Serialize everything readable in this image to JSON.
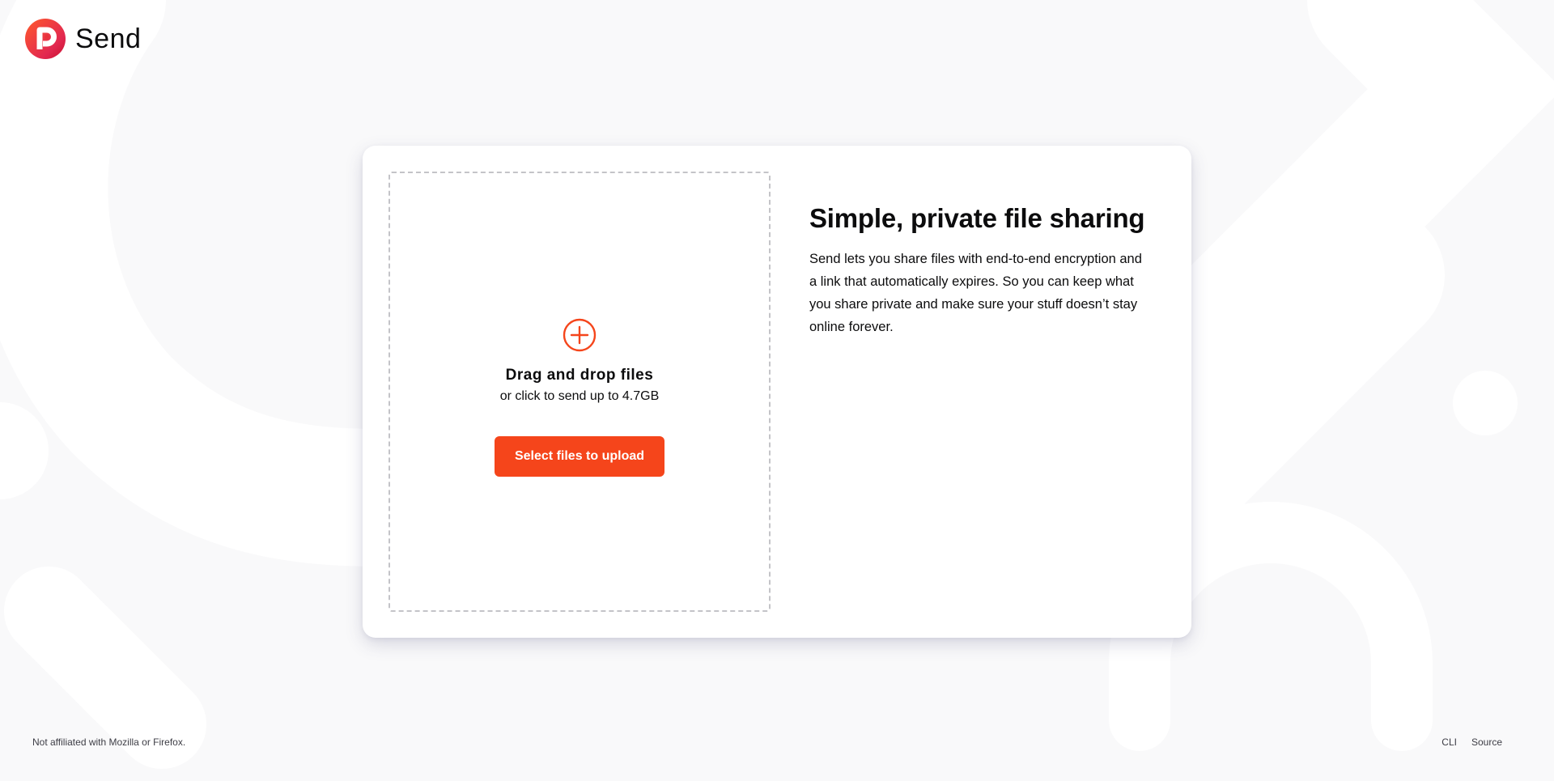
{
  "header": {
    "brand_name": "Send",
    "logo_icon": "send-logo-icon"
  },
  "upload": {
    "icon": "plus-circle-icon",
    "title": "Drag and drop files",
    "subtitle": "or click to send up to 4.7GB",
    "button_label": "Select files to upload"
  },
  "info": {
    "title": "Simple, private file sharing",
    "body": "Send lets you share files with end-to-end encryption and a link that automatically expires. So you can keep what you share private and make sure your stuff doesn’t stay online forever."
  },
  "footer": {
    "note": "Not affiliated with Mozilla or Firefox.",
    "links": [
      "CLI",
      "Source"
    ]
  },
  "colors": {
    "accent": "#f5451b",
    "background": "#f9f9fa",
    "card": "#ffffff",
    "text": "#0c0c0d"
  }
}
